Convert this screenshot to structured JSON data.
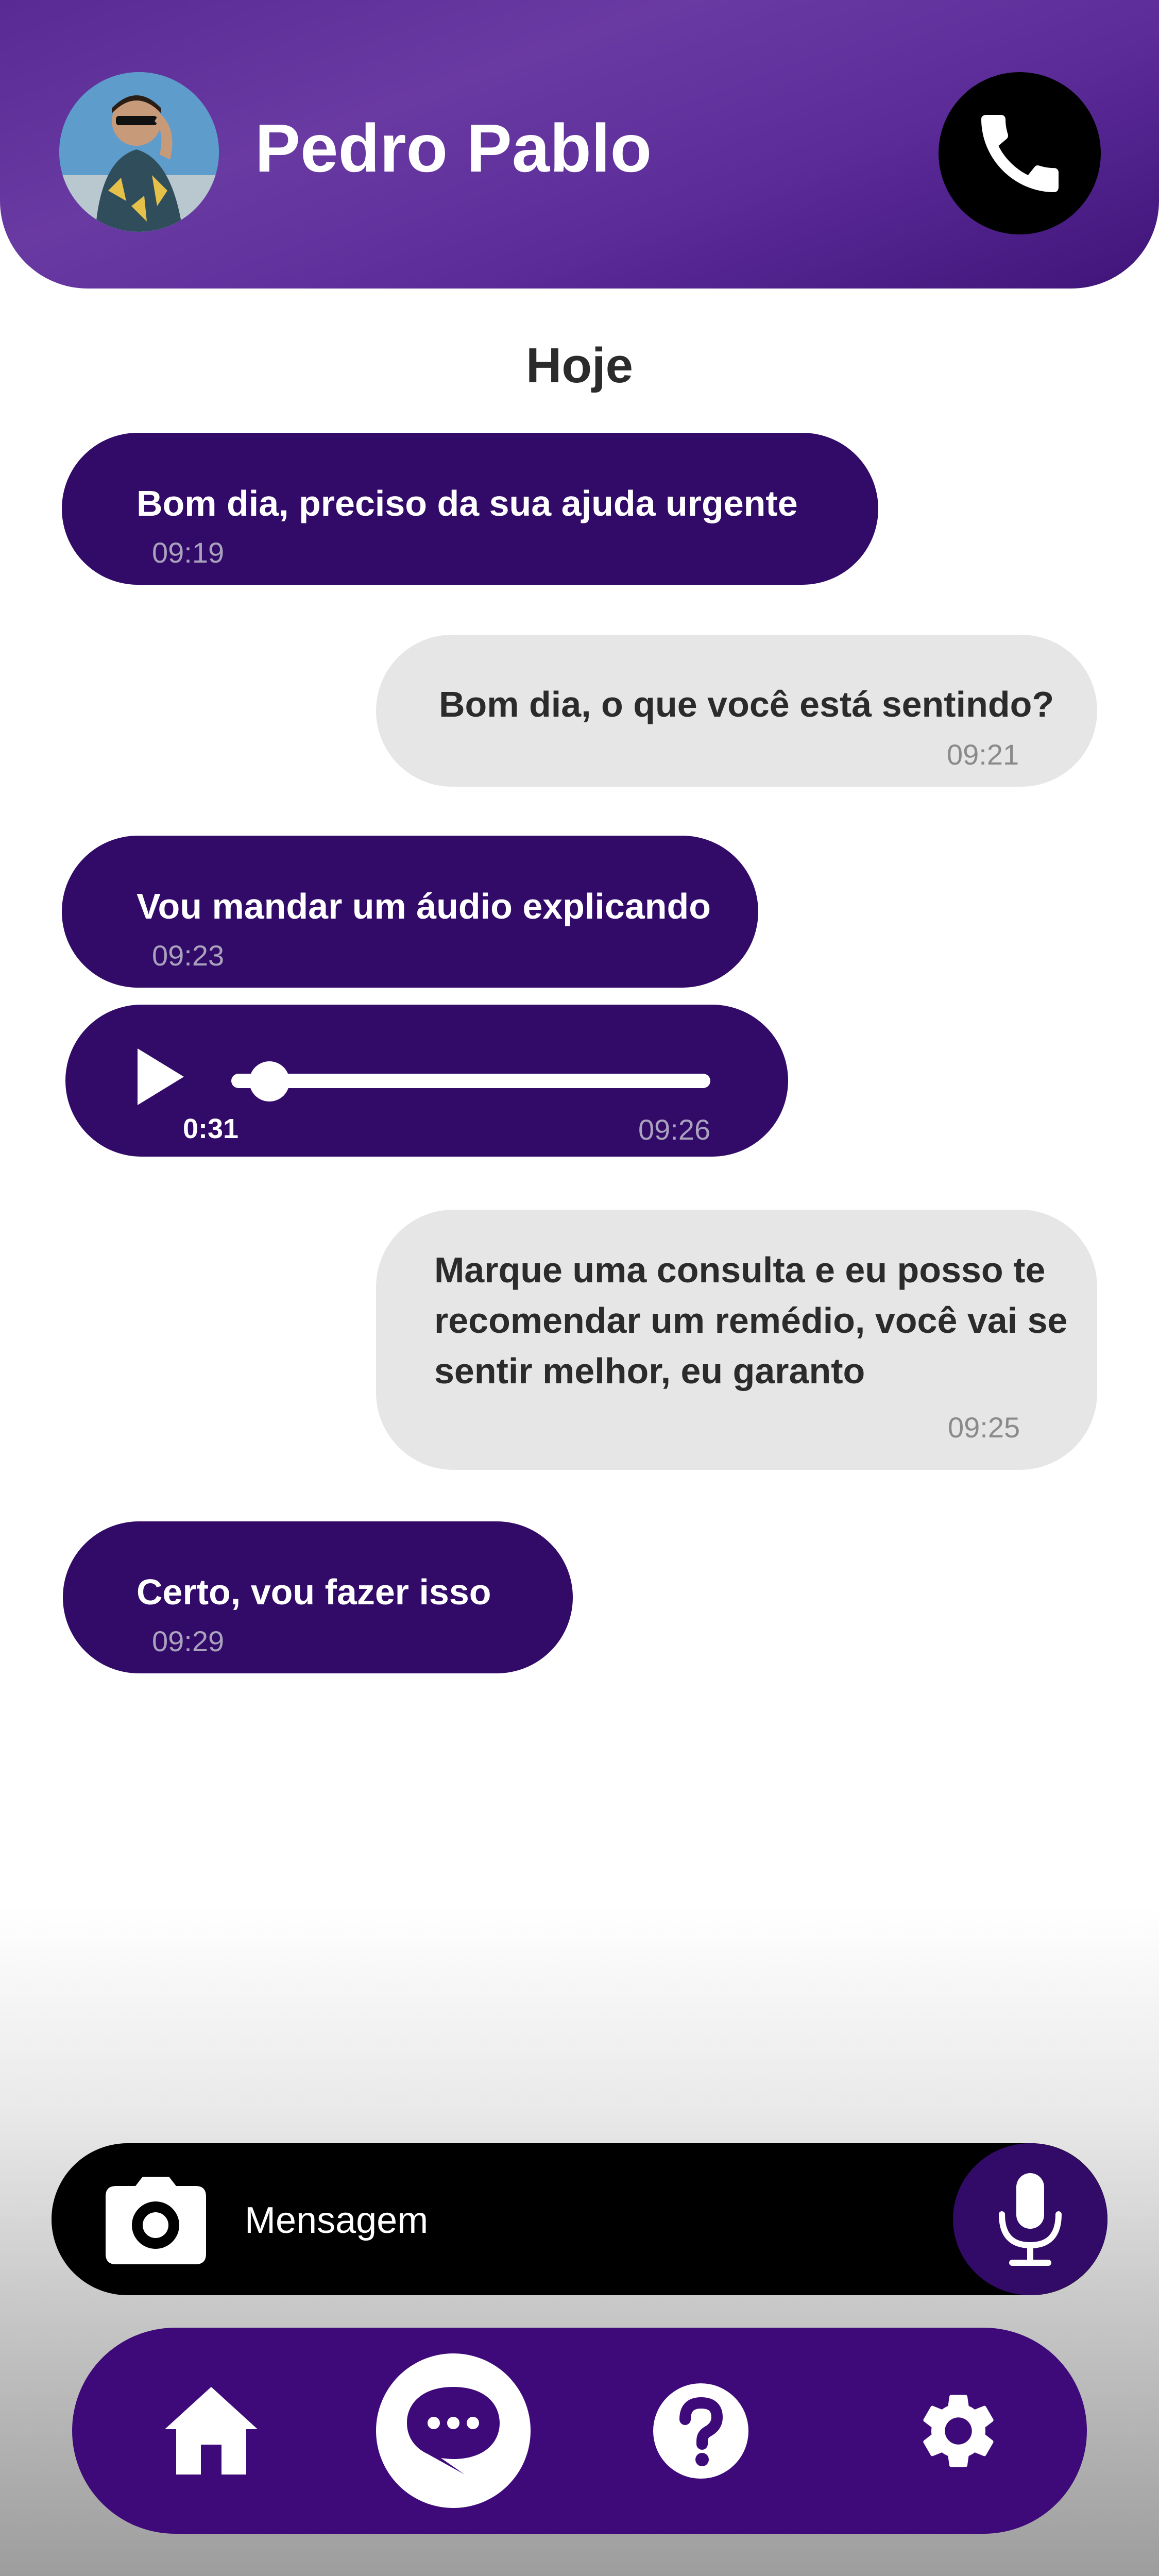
{
  "header": {
    "contact_name": "Pedro Pablo",
    "avatar_icon": "profile-photo",
    "call_icon": "phone-icon"
  },
  "chat": {
    "date_label": "Hoje",
    "messages": [
      {
        "direction": "received",
        "type": "text",
        "text": "Bom dia, preciso da sua ajuda urgente",
        "time": "09:19"
      },
      {
        "direction": "sent",
        "type": "text",
        "text": "Bom dia, o que você está sentindo?",
        "time": "09:21"
      },
      {
        "direction": "received",
        "type": "text",
        "text": "Vou mandar um áudio explicando",
        "time": "09:23"
      },
      {
        "direction": "received",
        "type": "audio",
        "duration": "0:31",
        "time": "09:26",
        "progress": 0.08
      },
      {
        "direction": "sent",
        "type": "text",
        "lines": [
          "Marque uma consulta e eu posso te",
          "recomendar um remédio, você vai se",
          "sentir melhor, eu garanto"
        ],
        "time": "09:25"
      },
      {
        "direction": "received",
        "type": "text",
        "text": "Certo, vou fazer isso",
        "time": "09:29"
      }
    ]
  },
  "composer": {
    "placeholder": "Mensagem",
    "camera_icon": "camera-icon",
    "mic_icon": "microphone-icon"
  },
  "nav": {
    "items": [
      {
        "icon": "home-icon"
      },
      {
        "icon": "chat-icon",
        "active": true
      },
      {
        "icon": "help-icon"
      },
      {
        "icon": "settings-icon"
      }
    ]
  },
  "colors": {
    "primary": "#320a68",
    "nav_bg": "#3e0a7a",
    "header_bg": "#5a2a94",
    "sent_bubble": "#e6e6e6"
  }
}
